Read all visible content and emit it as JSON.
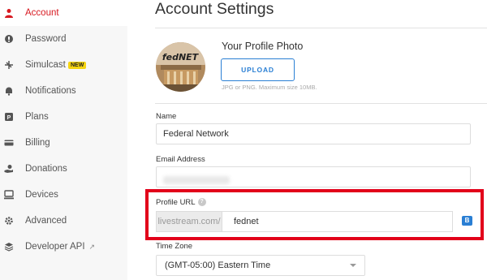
{
  "sidebar": {
    "items": [
      {
        "label": "Account",
        "icon": "user-icon"
      },
      {
        "label": "Password",
        "icon": "lock-icon"
      },
      {
        "label": "Simulcast",
        "icon": "broadcast-icon",
        "badge": "NEW"
      },
      {
        "label": "Notifications",
        "icon": "bell-icon"
      },
      {
        "label": "Plans",
        "icon": "plans-icon"
      },
      {
        "label": "Billing",
        "icon": "credit-card-icon"
      },
      {
        "label": "Donations",
        "icon": "donation-icon"
      },
      {
        "label": "Devices",
        "icon": "devices-icon"
      },
      {
        "label": "Advanced",
        "icon": "gear-icon"
      },
      {
        "label": "Developer API",
        "icon": "layers-icon"
      }
    ]
  },
  "main": {
    "title": "Account Settings",
    "photo": {
      "title": "Your Profile Photo",
      "upload_label": "UPLOAD",
      "hint": "JPG or PNG. Maximum size 10MB.",
      "avatar_text": "fedNET"
    },
    "name": {
      "label": "Name",
      "value": "Federal Network"
    },
    "email": {
      "label": "Email Address",
      "value": ""
    },
    "profile_url": {
      "label": "Profile URL",
      "prefix": "livestream.com/",
      "value": "fednet",
      "badge": "B"
    },
    "timezone": {
      "label": "Time Zone",
      "value": "(GMT-05:00) Eastern Time"
    }
  },
  "colors": {
    "accent": "#d71920",
    "link": "#2a7fd4",
    "highlight": "#e2001a",
    "badge_new": "#f5d40f"
  }
}
